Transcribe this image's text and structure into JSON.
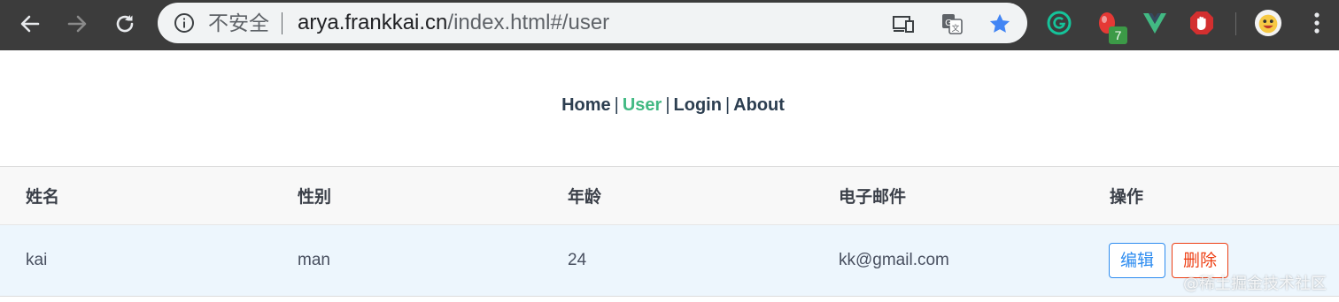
{
  "browser": {
    "security_label": "不安全",
    "url_host": "arya.frankkai.cn",
    "url_path": "/index.html#/user",
    "extension_badge": "7"
  },
  "nav": {
    "items": [
      "Home",
      "User",
      "Login",
      "About"
    ],
    "separator": "|",
    "active": "User"
  },
  "table": {
    "headers": [
      "姓名",
      "性别",
      "年龄",
      "电子邮件",
      "操作"
    ],
    "rows": [
      {
        "name": "kai",
        "gender": "man",
        "age": "24",
        "email": "kk@gmail.com",
        "edit_label": "编辑",
        "delete_label": "删除"
      }
    ]
  },
  "watermark": "@稀土掘金技术社区",
  "colors": {
    "chrome": "#3c3c3c",
    "active_link": "#42b983",
    "edit": "#2d8cf0",
    "delete": "#ed3f14",
    "row_highlight": "#edf6fd"
  }
}
